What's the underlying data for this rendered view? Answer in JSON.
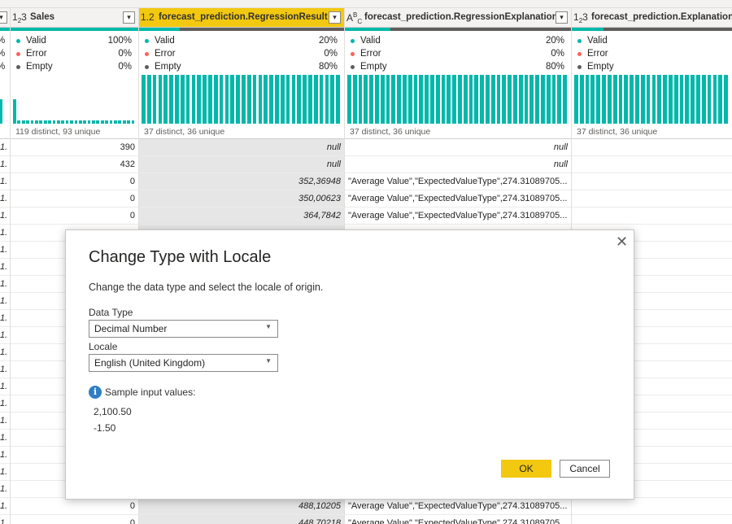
{
  "columns": [
    {
      "type_icon_main": "1",
      "type_icon_sub": "2",
      "type_icon_tail": "3",
      "name": "Sales",
      "quality": {
        "valid": "100%",
        "error": "0%",
        "empty": "0%",
        "valid_fraction": 1.0
      },
      "distribution_summary": "119 distinct, 93 unique"
    },
    {
      "type_icon": "1.2",
      "name": "forecast_prediction.RegressionResult",
      "quality": {
        "valid": "20%",
        "error": "0%",
        "empty": "80%",
        "valid_fraction": 0.2
      },
      "distribution_summary": "37 distinct, 36 unique"
    },
    {
      "type_icon_main": "A",
      "type_icon_sup": "B",
      "type_icon_sub": "C",
      "name": "forecast_prediction.RegressionExplanation",
      "quality": {
        "valid": "20%",
        "error": "0%",
        "empty": "80%",
        "valid_fraction": 0.2
      },
      "distribution_summary": "37 distinct, 36 unique"
    },
    {
      "type_icon_main": "1",
      "type_icon_sub": "2",
      "type_icon_tail": "3",
      "name": "forecast_prediction.ExplanationInd",
      "quality": {
        "valid": "Valid",
        "error": "Error",
        "empty": "Empty"
      },
      "distribution_summary": "37 distinct, 36 unique"
    }
  ],
  "quality_labels": {
    "valid": "Valid",
    "error": "Error",
    "empty": "Empty"
  },
  "left_edge": {
    "pct_fragment": "%",
    "cell_fragment": "1."
  },
  "rows_top": [
    {
      "sales": "390",
      "result": "null",
      "explanation": "null"
    },
    {
      "sales": "432",
      "result": "null",
      "explanation": "null"
    },
    {
      "sales": "0",
      "result": "352,36948",
      "explanation": "\"Average Value\",\"ExpectedValueType\",274.31089705..."
    },
    {
      "sales": "0",
      "result": "350,00623",
      "explanation": "\"Average Value\",\"ExpectedValueType\",274.31089705..."
    },
    {
      "sales": "0",
      "result": "364,7842",
      "explanation": "\"Average Value\",\"ExpectedValueType\",274.31089705..."
    }
  ],
  "rows_bottom": [
    {
      "sales": "0",
      "result": "488,10205",
      "explanation": "\"Average Value\",\"ExpectedValueType\",274.31089705..."
    },
    {
      "sales": "0",
      "result": "448,70218",
      "explanation": "\"Average Value\",\"ExpectedValueType\",274.31089705..."
    }
  ],
  "dialog": {
    "title": "Change Type with Locale",
    "description": "Change the data type and select the locale of origin.",
    "data_type_label": "Data Type",
    "data_type_value": "Decimal Number",
    "locale_label": "Locale",
    "locale_value": "English (United Kingdom)",
    "sample_label": "Sample input values:",
    "sample_values": [
      "2,100.50",
      "-1.50"
    ],
    "ok_label": "OK",
    "cancel_label": "Cancel",
    "close_glyph": "✕",
    "info_glyph": "i",
    "caret_glyph": "▼"
  },
  "colors": {
    "valid": "#01b8aa",
    "error": "#fd625e",
    "empty": "#605e5c",
    "accent": "#f2c811"
  }
}
